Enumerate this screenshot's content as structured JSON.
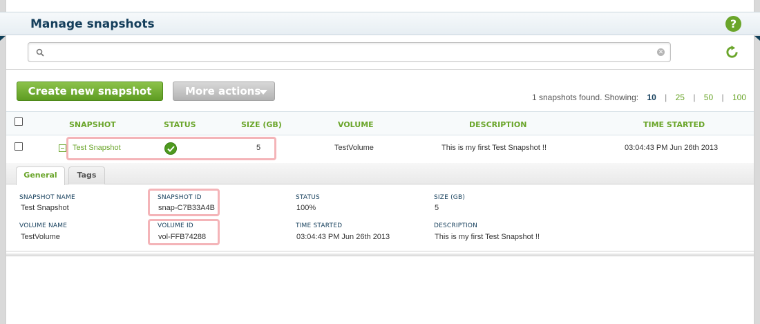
{
  "header": {
    "title": "Manage snapshots",
    "help_glyph": "?"
  },
  "search": {
    "value": "",
    "placeholder": ""
  },
  "actions": {
    "create_label": "Create new snapshot",
    "more_label": "More actions"
  },
  "results": {
    "summary": "1 snapshots found. Showing:",
    "page_sizes": [
      "10",
      "25",
      "50",
      "100"
    ],
    "current_page_size": "10"
  },
  "table": {
    "columns": [
      "SNAPSHOT",
      "STATUS",
      "SIZE (GB)",
      "VOLUME",
      "DESCRIPTION",
      "TIME STARTED"
    ],
    "rows": [
      {
        "snapshot": "Test Snapshot",
        "status": "ok",
        "size": "5",
        "volume": "TestVolume",
        "description": "This is my first Test Snapshot !!",
        "time_started": "03:04:43 PM Jun 26th 2013"
      }
    ]
  },
  "details": {
    "tabs": [
      "General",
      "Tags"
    ],
    "active_tab": "General",
    "fields": {
      "snapshot_name": {
        "label": "SNAPSHOT NAME",
        "value": "Test Snapshot"
      },
      "snapshot_id": {
        "label": "SNAPSHOT ID",
        "value": "snap-C7B33A4B"
      },
      "status": {
        "label": "STATUS",
        "value": "100%"
      },
      "size": {
        "label": "SIZE (GB)",
        "value": "5"
      },
      "volume_name": {
        "label": "VOLUME NAME",
        "value": "TestVolume"
      },
      "volume_id": {
        "label": "VOLUME ID",
        "value": "vol-FFB74288"
      },
      "time_started": {
        "label": "TIME STARTED",
        "value": "03:04:43 PM Jun 26th 2013"
      },
      "description": {
        "label": "DESCRIPTION",
        "value": "This is my first Test Snapshot !!"
      }
    }
  },
  "colors": {
    "accent": "#6aa52a",
    "title": "#143e5b",
    "highlight": "#f4b4b8"
  },
  "icons": [
    "help-icon",
    "search-icon",
    "clear-icon",
    "refresh-icon",
    "chevron-down-icon",
    "collapse-icon",
    "status-ok-icon"
  ]
}
